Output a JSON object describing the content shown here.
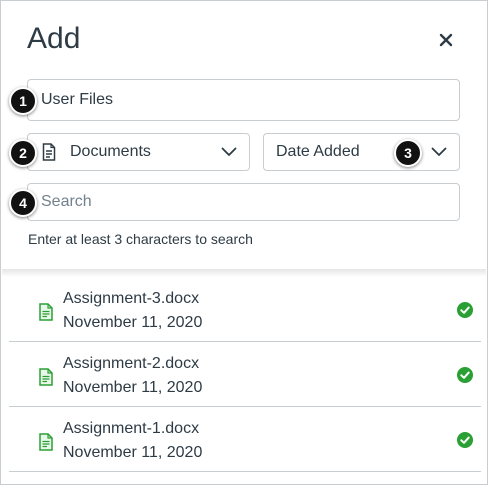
{
  "header": {
    "title": "Add",
    "close_label": "×"
  },
  "source_select": {
    "value": "User Files"
  },
  "type_select": {
    "value": "Documents"
  },
  "sort_select": {
    "value": "Date Added"
  },
  "search": {
    "placeholder": "Search",
    "value": ""
  },
  "hint": "Enter at least 3 characters to search",
  "files": [
    {
      "name": "Assignment-3.docx",
      "date": "November 11, 2020"
    },
    {
      "name": "Assignment-2.docx",
      "date": "November 11, 2020"
    },
    {
      "name": "Assignment-1.docx",
      "date": "November 11, 2020"
    }
  ],
  "callouts": [
    "1",
    "2",
    "3",
    "4"
  ],
  "colors": {
    "accent_green": "#2aa034",
    "text": "#2d3b45",
    "border": "#c7cdd1"
  },
  "icons": [
    "close-icon",
    "document-icon",
    "chevron-down-icon",
    "file-doc-icon",
    "check-circle-icon"
  ]
}
